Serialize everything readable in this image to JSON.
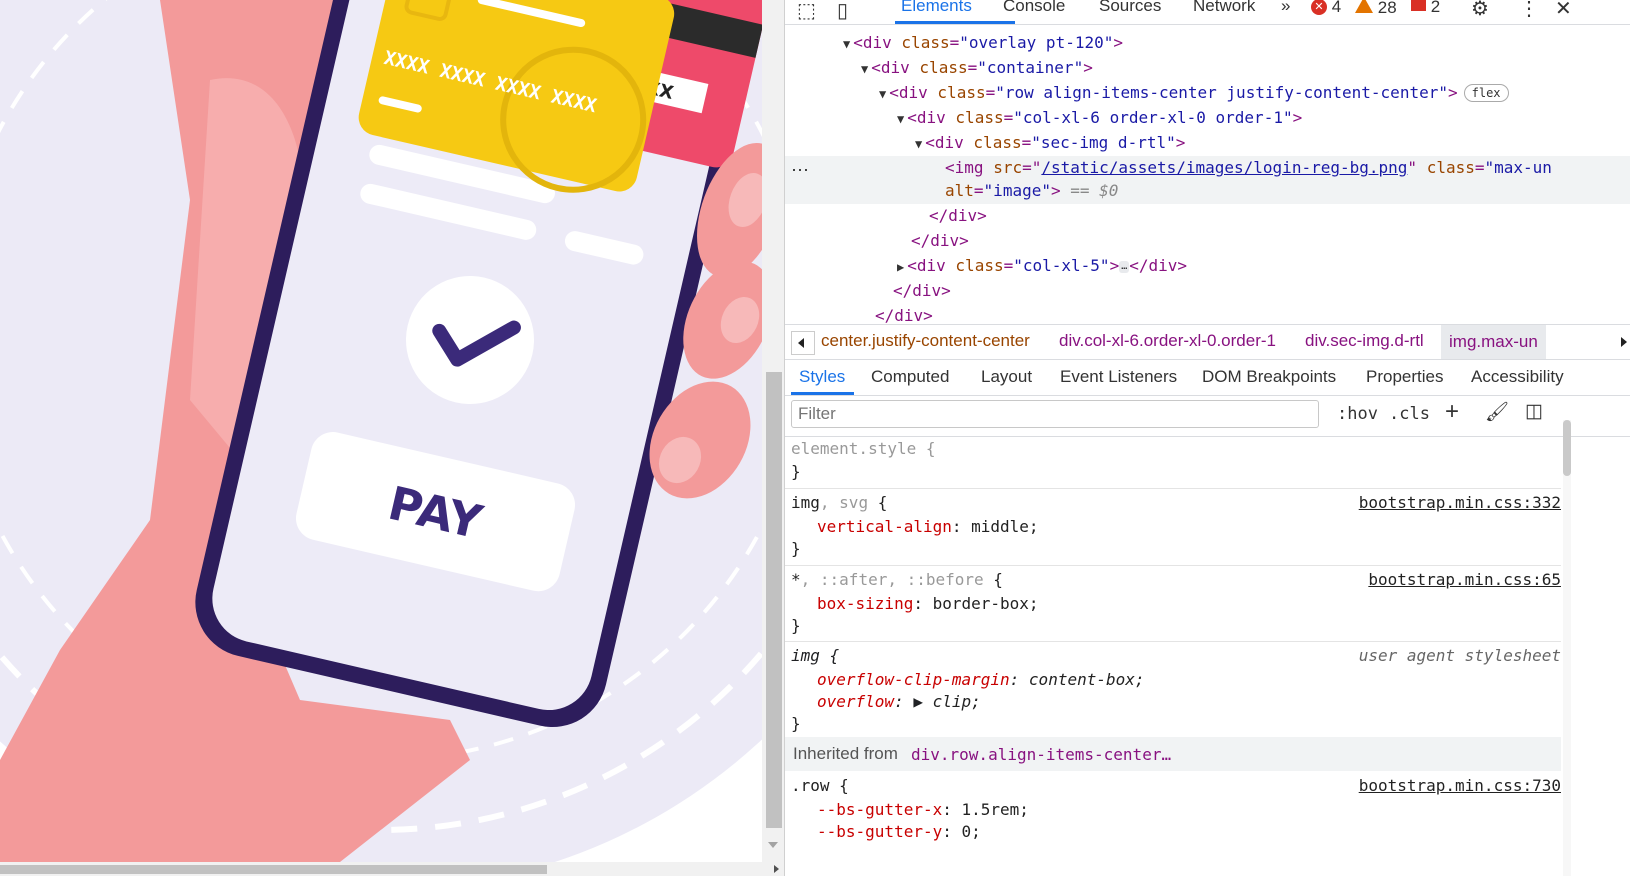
{
  "left": {
    "pay_label": "PAY",
    "card_front_number": "XXXX XXXX XXXX XXXX",
    "card_back_code": "XX"
  },
  "devtools": {
    "tabs": [
      "Elements",
      "Console",
      "Sources",
      "Network"
    ],
    "active_tab": "Elements",
    "errors": "4",
    "warnings": "28",
    "issues": "2",
    "colors": {
      "accent": "#1a73e8",
      "tag": "#881280",
      "attr_name": "#994500",
      "attr_value": "#1a1aa6",
      "property": "#c80000"
    },
    "dom": {
      "l1_tag": "div",
      "l1_attr": "class",
      "l1_val": "\"overlay pt-120\"",
      "l2_tag": "div",
      "l2_attr": "class",
      "l2_val": "\"container\"",
      "l3_tag": "div",
      "l3_attr": "class",
      "l3_val": "\"row align-items-center justify-content-center\"",
      "l3_badge": "flex",
      "l4_tag": "div",
      "l4_attr": "class",
      "l4_val": "\"col-xl-6 order-xl-0 order-1\"",
      "l5_tag": "div",
      "l5_attr": "class",
      "l5_val": "\"sec-img d-rtl\"",
      "img_tag": "img",
      "img_src_attr": "src",
      "img_src": "/static/assets/images/login-reg-bg.png",
      "img_class_attr": "class",
      "img_class": "\"max-un",
      "img_alt_attr": "alt",
      "img_alt": "\"image\"",
      "img_hint": "== $0",
      "close_div": "</div>",
      "l6_tag": "div",
      "l6_attr": "class",
      "l6_val": "\"col-xl-5\"",
      "ellipsis": "…"
    },
    "breadcrumbs": [
      "center.justify-content-center",
      "div.col-xl-6.order-xl-0.order-1",
      "div.sec-img.d-rtl",
      "img.max-un"
    ],
    "style_tabs": [
      "Styles",
      "Computed",
      "Layout",
      "Event Listeners",
      "DOM Breakpoints",
      "Properties",
      "Accessibility"
    ],
    "active_style_tab": "Styles",
    "filter_placeholder": "Filter",
    "filter_tools": {
      "hov": ":hov",
      "cls": ".cls",
      "add": "+"
    },
    "rules": {
      "element_style": "element.style {",
      "close_brace": "}",
      "r1_sel_a": "img",
      "r1_sel_b": ", svg",
      "r1_open": " {",
      "r1_src": "bootstrap.min.css:332",
      "r1_prop": "vertical-align",
      "r1_val": "middle;",
      "r2_sel_a": "*",
      "r2_sel_b": ", ::after, ::before",
      "r2_open": " {",
      "r2_src": "bootstrap.min.css:65",
      "r2_prop": "box-sizing",
      "r2_val": "border-box;",
      "r3_sel": "img {",
      "r3_src": "user agent stylesheet",
      "r3_prop1": "overflow-clip-margin",
      "r3_val1": "content-box;",
      "r3_prop2": "overflow",
      "r3_val2": "clip;",
      "inherited_label": "Inherited from",
      "inherited_from": "div.row.align-items-center…",
      "r4_sel": ".row {",
      "r4_src": "bootstrap.min.css:730",
      "r4_prop1": "--bs-gutter-x",
      "r4_val1": "1.5rem;",
      "r4_prop2": "--bs-gutter-y",
      "r4_val2": "0;"
    }
  }
}
